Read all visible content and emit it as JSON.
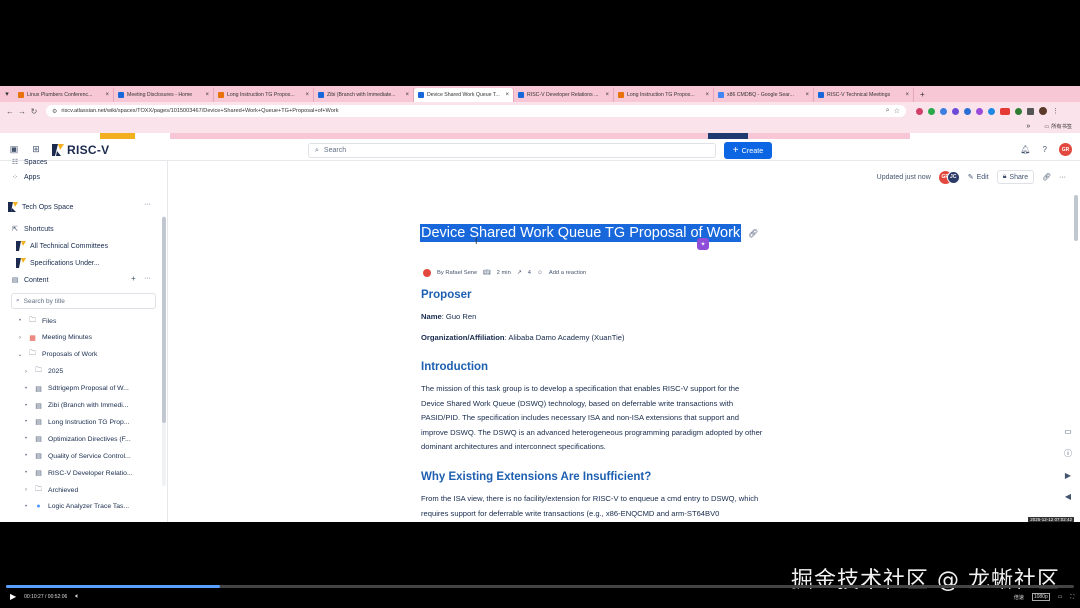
{
  "browser": {
    "tabs": [
      {
        "title": "Linux Plumbers Conferenc..."
      },
      {
        "title": "Meeting Disclosures - Home"
      },
      {
        "title": "Long Instruction TG Propos..."
      },
      {
        "title": "Zibi (Branch with Immediate..."
      },
      {
        "title": "Device Shared Work Queue T..."
      },
      {
        "title": "RISC-V Developer Relations ..."
      },
      {
        "title": "Long Instruction TG Propos..."
      },
      {
        "title": "x86 CMDBQ - Google Sear..."
      },
      {
        "title": "RISC-V Technical Meetings"
      }
    ],
    "new_tab": "+",
    "url": "riscv.atlassian.net/wiki/spaces/TOXX/pages/1015003467/Device+Shared+Work+Queue+TG+Proposal+of+Work",
    "bookmarks_folder": "所有书签",
    "bookmarks_more": "»"
  },
  "topnav": {
    "brand": "RISC-V",
    "search_placeholder": "Search",
    "create_label": "Create",
    "user_initials": "GR"
  },
  "sidebar": {
    "spaces_label": "Spaces",
    "apps_label": "Apps",
    "space_name": "Tech Ops Space",
    "shortcuts_label": "Shortcuts",
    "shortcuts": [
      "All Technical Committees",
      "Specifications Under..."
    ],
    "content_label": "Content",
    "search_placeholder": "Search by title",
    "tree": [
      {
        "label": "Files",
        "kind": "folder",
        "indent": 0,
        "toggle": "bullet"
      },
      {
        "label": "Meeting Minutes",
        "kind": "calendar",
        "indent": 0,
        "toggle": "chev-right"
      },
      {
        "label": "Proposals of Work",
        "kind": "folder",
        "indent": 0,
        "toggle": "chev-down"
      },
      {
        "label": "2025",
        "kind": "folder",
        "indent": 1,
        "toggle": "chev-right"
      },
      {
        "label": "Sdtrigepm Proposal of W...",
        "kind": "page",
        "indent": 1,
        "toggle": "bullet"
      },
      {
        "label": "Zibi (Branch with Immedi...",
        "kind": "page",
        "indent": 1,
        "toggle": "bullet"
      },
      {
        "label": "Long Instruction TG Prop...",
        "kind": "page",
        "indent": 1,
        "toggle": "bullet"
      },
      {
        "label": "Optimization Directives (F...",
        "kind": "page",
        "indent": 1,
        "toggle": "bullet"
      },
      {
        "label": "Quality of Service Control...",
        "kind": "page",
        "indent": 1,
        "toggle": "bullet"
      },
      {
        "label": "RISC-V Developer Relatio...",
        "kind": "page",
        "indent": 1,
        "toggle": "bullet"
      },
      {
        "label": "Archieved",
        "kind": "folder",
        "indent": 1,
        "toggle": "chev-right"
      },
      {
        "label": "Logic Analyzer Trace Tas...",
        "kind": "circle",
        "indent": 1,
        "toggle": "bullet"
      }
    ]
  },
  "page": {
    "updated": "Updated just now",
    "avatars": [
      "GR",
      "JC"
    ],
    "edit_label": "Edit",
    "share_label": "Share",
    "title": "Device Shared Work Queue TG Proposal of Work",
    "author": "By Rafael Sene",
    "read_time": "2 min",
    "views": "4",
    "reaction": "Add a reaction",
    "sections": {
      "proposer_heading": "Proposer",
      "name_label": "Name",
      "name_value": ": Guo Ren",
      "org_label": "Organization/Affiliation",
      "org_value": ": Alibaba Damo Academy (XuanTie)",
      "intro_heading": "Introduction",
      "intro_lines": [
        "The mission of this task group is to develop a specification that enables RISC-V support for the",
        "Device Shared Work Queue (DSWQ) technology, based on deferrable write transactions with",
        "PASID/PID. The specification includes necessary ISA and non-ISA extensions that support and",
        "improve DSWQ. The DSWQ is an advanced heterogeneous programming paradigm adopted by other",
        "dominant architectures and interconnect specifications."
      ],
      "why_heading": "Why Existing Extensions Are Insufficient?",
      "why_lines": [
        "From the ISA view, there is no facility/extension for RISC-V to enqueue a cmd entry to DSWQ, which",
        "requires support for deferrable write transactions (e.g., x86-ENQCMD and arm-ST64BV0"
      ]
    },
    "timestamp_overlay": "2025-12-12 07:02:42"
  },
  "video": {
    "watermark": "掘金技术社区 @ 龙蜥社区",
    "time": "00:10:27 / 00:52:06",
    "progress": 0.2,
    "speed_label": "倍速",
    "quality_label": "1080p"
  },
  "colors": {
    "tabstrip": "#f7c7d6",
    "accent": "#0c66e4",
    "heading": "#1d5fb0",
    "selection": "#1868db"
  }
}
